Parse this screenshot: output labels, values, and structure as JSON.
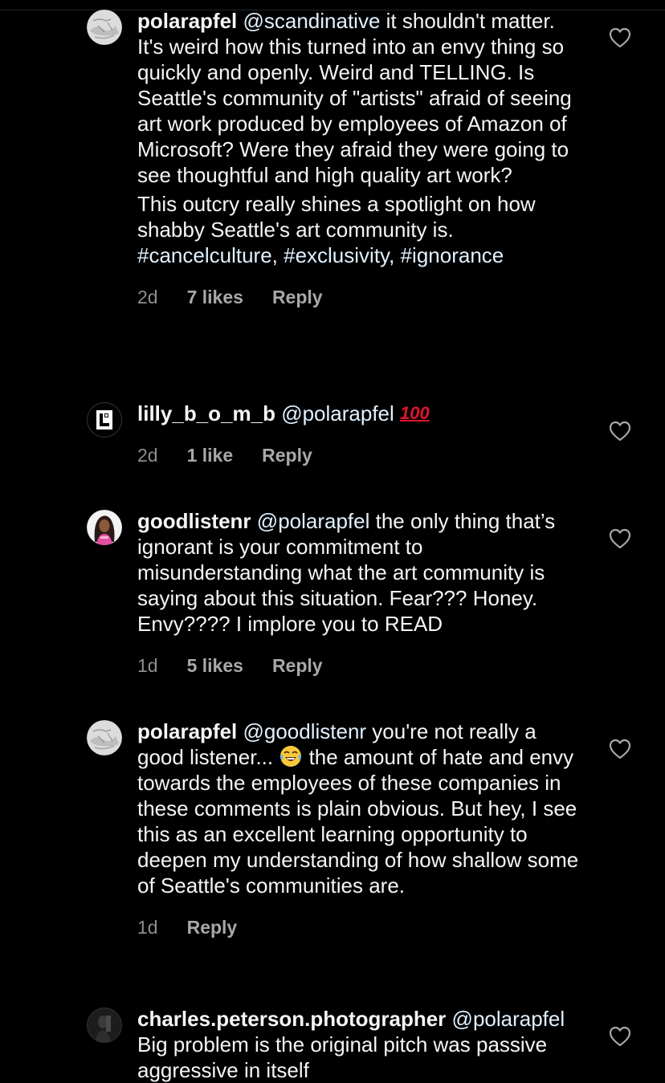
{
  "comments": [
    {
      "username": "polarapfel",
      "mention": "@scandinative",
      "text1": " it shouldn't matter. It's weird how this turned into an envy thing so quickly and openly. Weird and TELLING. Is Seattle's community of \"artists\" afraid of seeing art work produced by employees of Amazon of Microsoft? Were they afraid they were going to see thoughtful and high quality art work?",
      "text2": "This outcry really shines a spotlight on how shabby Seattle's art community is. ",
      "hashtags": [
        "#cancelculture",
        "#exclusivity",
        "#ignorance"
      ],
      "time": "2d",
      "likes": "7 likes",
      "reply": "Reply"
    },
    {
      "username": "lilly_b_o_m_b",
      "mention": "@polarapfel",
      "emoji": "100",
      "time": "2d",
      "likes": "1 like",
      "reply": "Reply"
    },
    {
      "username": "goodlistenr",
      "mention": "@polarapfel",
      "text": " the only thing that’s ignorant is your commitment to misunderstanding what the art community is saying about this situation. Fear??? Honey. Envy???? I implore you to READ",
      "time": "1d",
      "likes": "5 likes",
      "reply": "Reply"
    },
    {
      "username": "polarapfel",
      "mention": "@goodlistenr",
      "text1": " you're not really a good listener... ",
      "text2": " the amount of hate and envy towards the employees of these companies in these comments is plain obvious. But hey, I see this as an excellent learning opportunity to deepen my understanding of how shallow some of Seattle's communities are.",
      "time": "1d",
      "reply": "Reply"
    },
    {
      "username": "charles.peterson.photographer",
      "mention": "@polarapfel",
      "text": " Big problem is the original pitch was passive aggressive in itself"
    }
  ],
  "colors": {
    "background": "#000000",
    "text": "#f5f5f5",
    "mention": "#e0f1ff",
    "meta": "#a8a8a8",
    "heart_stroke": "#a8a8a8"
  },
  "icons": [
    "heart-icon",
    "laughing-emoji",
    "hundred-points-emoji"
  ]
}
